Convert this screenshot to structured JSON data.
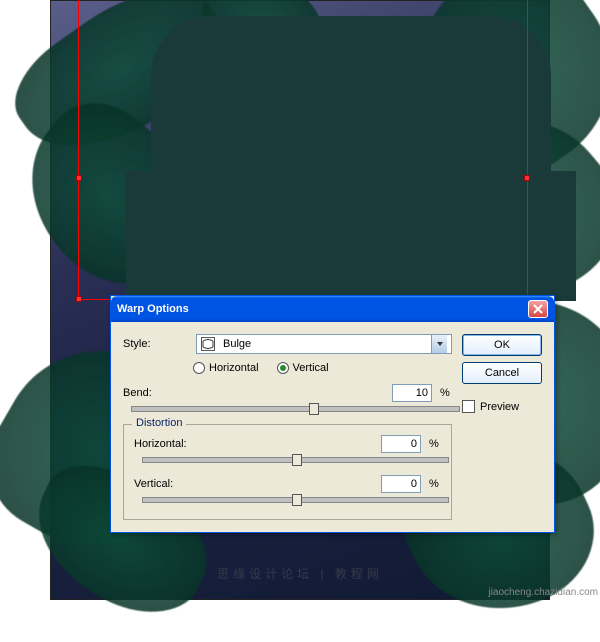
{
  "dialog": {
    "title": "Warp Options",
    "style_label": "Style:",
    "style_value": "Bulge",
    "orientation": {
      "horizontal_label": "Horizontal",
      "vertical_label": "Vertical",
      "selected": "Vertical"
    },
    "bend": {
      "label": "Bend:",
      "value": "10",
      "suffix": "%"
    },
    "distortion": {
      "legend": "Distortion",
      "horizontal": {
        "label": "Horizontal:",
        "value": "0",
        "suffix": "%"
      },
      "vertical": {
        "label": "Vertical:",
        "value": "0",
        "suffix": "%"
      }
    },
    "buttons": {
      "ok": "OK",
      "cancel": "Cancel",
      "preview": "Preview"
    }
  },
  "watermark": {
    "site": "jiaocheng.chazidian.com",
    "cn": "思缘设计论坛 | 教程网"
  }
}
